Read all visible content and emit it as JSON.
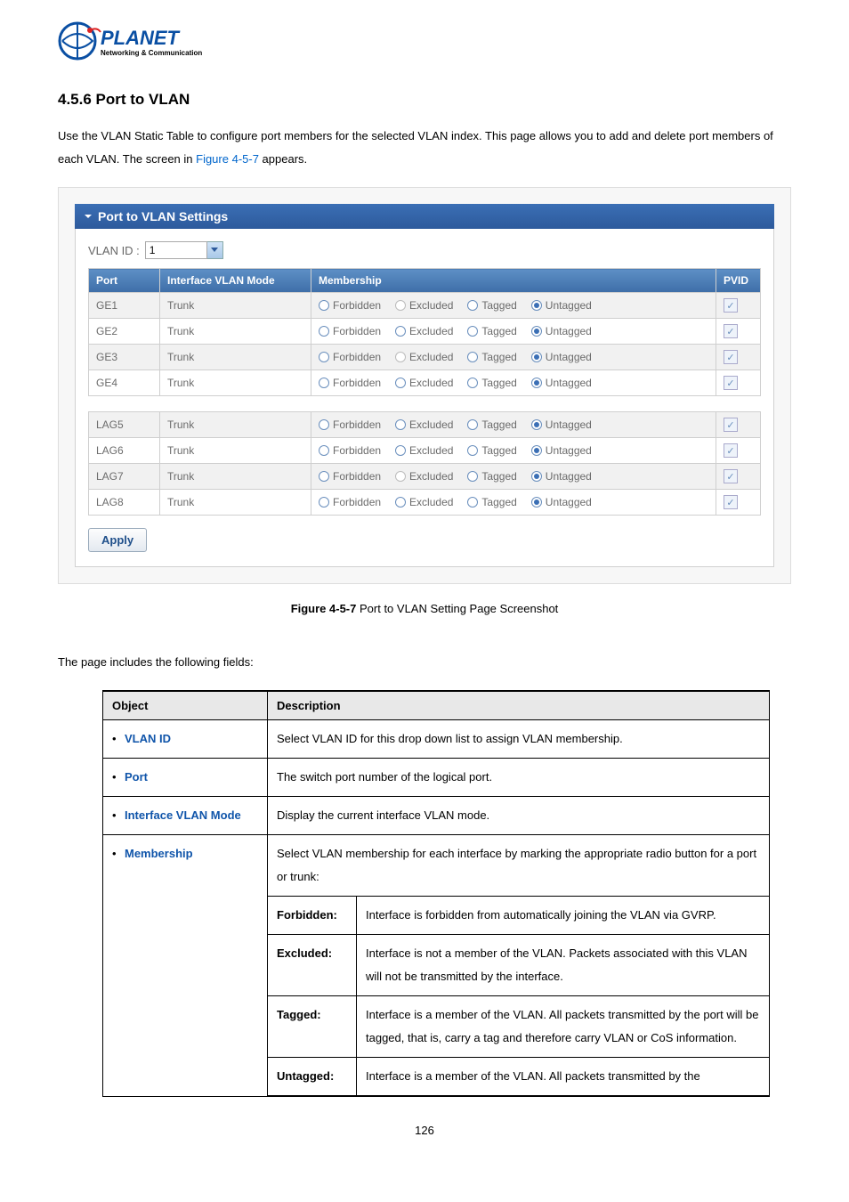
{
  "logo": {
    "brand": "PLANET",
    "tagline": "Networking & Communication"
  },
  "heading": "4.5.6 Port to VLAN",
  "intro_part1": "Use the VLAN Static Table to configure port members for the selected VLAN index. This page allows you to add and delete port members of each VLAN. The screen in ",
  "intro_link": "Figure 4-5-7",
  "intro_part2": " appears.",
  "panel_title": "Port to VLAN Settings",
  "vlan_id_label": "VLAN ID :",
  "vlan_id_value": "1",
  "columns": {
    "port": "Port",
    "mode": "Interface VLAN Mode",
    "membership": "Membership",
    "pvid": "PVID"
  },
  "membership_labels": {
    "forbidden": "Forbidden",
    "excluded": "Excluded",
    "tagged": "Tagged",
    "untagged": "Untagged"
  },
  "rows_top": [
    {
      "port": "GE1",
      "mode": "Trunk",
      "selected": "untagged",
      "excluded_disabled": true,
      "pvid_checked": true
    },
    {
      "port": "GE2",
      "mode": "Trunk",
      "selected": "untagged",
      "excluded_disabled": false,
      "pvid_checked": true
    },
    {
      "port": "GE3",
      "mode": "Trunk",
      "selected": "untagged",
      "excluded_disabled": true,
      "pvid_checked": true
    },
    {
      "port": "GE4",
      "mode": "Trunk",
      "selected": "untagged",
      "excluded_disabled": false,
      "pvid_checked": true
    }
  ],
  "rows_bottom": [
    {
      "port": "LAG5",
      "mode": "Trunk",
      "selected": "untagged",
      "excluded_disabled": false,
      "pvid_checked": true
    },
    {
      "port": "LAG6",
      "mode": "Trunk",
      "selected": "untagged",
      "excluded_disabled": false,
      "pvid_checked": true
    },
    {
      "port": "LAG7",
      "mode": "Trunk",
      "selected": "untagged",
      "excluded_disabled": true,
      "pvid_checked": true
    },
    {
      "port": "LAG8",
      "mode": "Trunk",
      "selected": "untagged",
      "excluded_disabled": false,
      "pvid_checked": true
    }
  ],
  "apply_label": "Apply",
  "figure_label": "Figure 4-5-7",
  "figure_text": " Port to VLAN Setting Page Screenshot",
  "desc_intro": "The page includes the following fields:",
  "desc_headers": {
    "object": "Object",
    "description": "Description"
  },
  "desc_rows": [
    {
      "object": "VLAN ID",
      "desc": "Select VLAN ID for this drop down list to assign VLAN membership."
    },
    {
      "object": "Port",
      "desc": "The switch port number of the logical port."
    },
    {
      "object": "Interface VLAN Mode",
      "desc": "Display the current interface VLAN mode."
    }
  ],
  "membership_object": "Membership",
  "membership_intro": "Select VLAN membership for each interface by marking the appropriate radio button for a port or trunk:",
  "membership_subrows": [
    {
      "label": "Forbidden:",
      "desc": "Interface is forbidden from automatically joining the VLAN via GVRP."
    },
    {
      "label": "Excluded:",
      "desc": "Interface is not a member of the VLAN. Packets associated with this VLAN will not be transmitted by the interface."
    },
    {
      "label": "Tagged:",
      "desc": "Interface is a member of the VLAN. All packets transmitted by the port will be tagged, that is, carry a tag and therefore carry VLAN or CoS information."
    },
    {
      "label": "Untagged:",
      "desc": "Interface is a member of the VLAN. All packets transmitted by the"
    }
  ],
  "page_number": "126"
}
